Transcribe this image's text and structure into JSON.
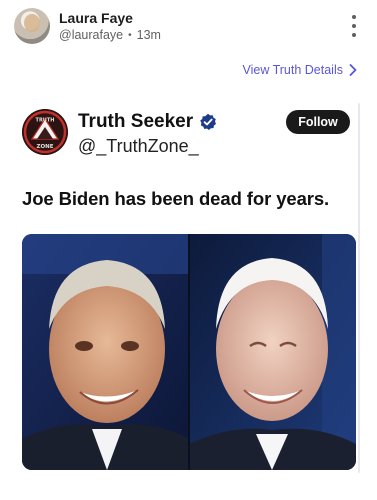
{
  "post": {
    "author_name": "Laura Faye",
    "author_handle": "@laurafaye",
    "separator": "•",
    "time_ago": "13m",
    "icons": {
      "more": "more-vertical-icon",
      "chevron": "chevron-right-icon"
    }
  },
  "view_details": {
    "label": "View Truth Details"
  },
  "quoted": {
    "display_name": "Truth Seeker",
    "handle": "@_TruthZone_",
    "follow_label": "Follow",
    "text": "Joe Biden has been dead for years.",
    "verified_icon": "verified-badge-icon",
    "logo_top": "TRUTH",
    "logo_bottom": "ZONE"
  },
  "colors": {
    "link": "#5a57d6",
    "follow_bg": "#1a1a1a",
    "verified": "#1e3a8a"
  }
}
